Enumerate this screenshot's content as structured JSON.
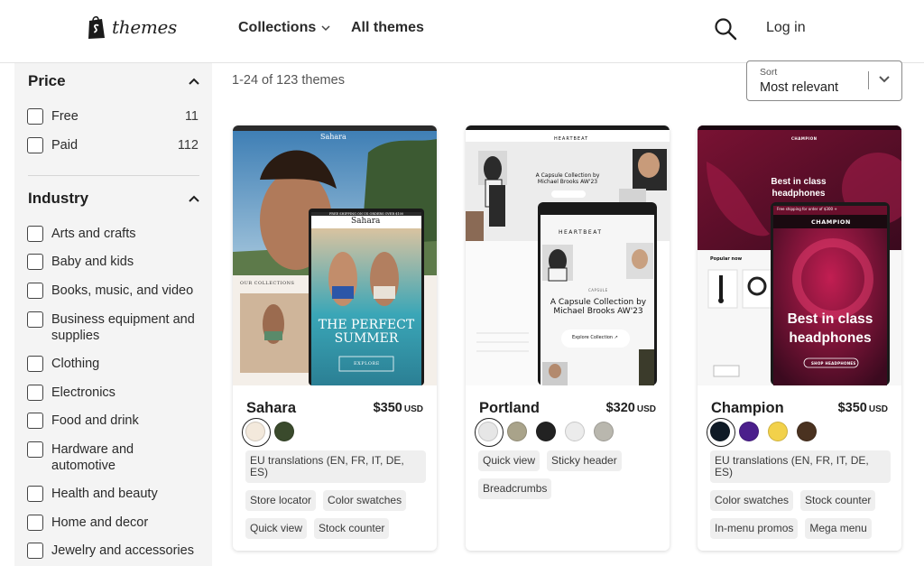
{
  "header": {
    "logo_text": "themes",
    "nav": [
      {
        "label": "Collections"
      },
      {
        "label": "All themes"
      }
    ],
    "login_label": "Log in"
  },
  "sidebar": {
    "price": {
      "title": "Price",
      "options": [
        {
          "label": "Free",
          "count": "11"
        },
        {
          "label": "Paid",
          "count": "112"
        }
      ]
    },
    "industry": {
      "title": "Industry",
      "options": [
        {
          "label": "Arts and crafts"
        },
        {
          "label": "Baby and kids"
        },
        {
          "label": "Books, music, and video"
        },
        {
          "label": "Business equipment and supplies"
        },
        {
          "label": "Clothing"
        },
        {
          "label": "Electronics"
        },
        {
          "label": "Food and drink"
        },
        {
          "label": "Hardware and automotive"
        },
        {
          "label": "Health and beauty"
        },
        {
          "label": "Home and decor"
        },
        {
          "label": "Jewelry and accessories"
        }
      ]
    }
  },
  "results": {
    "count_text": "1-24 of 123 themes",
    "sort_label": "Sort",
    "sort_value": "Most relevant"
  },
  "themes": [
    {
      "name": "Sahara",
      "price": "$350",
      "currency": "USD",
      "swatches": [
        "#f3e9dc",
        "#3a4a2c"
      ],
      "tags": [
        "EU translations (EN, FR, IT, DE, ES)",
        "Store locator",
        "Color swatches",
        "Quick view",
        "Stock counter"
      ],
      "preview": {
        "brand": "Sahara",
        "headline": "THE PERFECT SUMMER",
        "banner": "FREE SHIPPING ON US ORDERS OVER $100",
        "section": "OUR COLLECTIONS",
        "cta": "EXPLORE"
      }
    },
    {
      "name": "Portland",
      "price": "$320",
      "currency": "USD",
      "swatches": [
        "#e6e6e6",
        "#a9a38a",
        "#222222",
        "#ececec",
        "#b9b7ae"
      ],
      "tags": [
        "Quick view",
        "Sticky header",
        "Breadcrumbs"
      ],
      "preview": {
        "brand": "HEARTBEAT",
        "headline": "A Capsule Collection by Michael Brooks AW'23",
        "capsule": "CAPSULE",
        "cta": "Explore Collection ↗"
      }
    },
    {
      "name": "Champion",
      "price": "$350",
      "currency": "USD",
      "swatches": [
        "#0f1a26",
        "#4b1f8c",
        "#f2d14a",
        "#4a3220"
      ],
      "tags": [
        "EU translations (EN, FR, IT, DE, ES)",
        "Color swatches",
        "Stock counter",
        "In-menu promos",
        "Mega menu"
      ],
      "preview": {
        "brand": "CHAMPION",
        "headline": "Best in class headphones",
        "banner": "Free shipping for order of $300 +",
        "section": "Popular now",
        "cta": "SHOP HEADPHONES"
      }
    }
  ]
}
